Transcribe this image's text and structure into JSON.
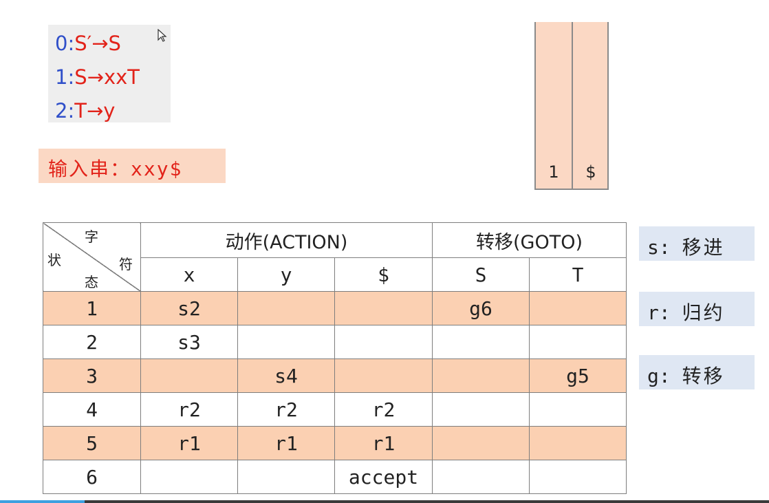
{
  "grammar": {
    "rules": [
      {
        "num": "0:",
        "body": "S′→S"
      },
      {
        "num": "1:",
        "body": "S→xxT"
      },
      {
        "num": "2:",
        "body": "T→y"
      }
    ]
  },
  "input": {
    "label": "输入串：",
    "value": "xxy$"
  },
  "stack": {
    "state": "1",
    "symbol": "$"
  },
  "table": {
    "corner": {
      "top": "字",
      "left": "状",
      "right": "符",
      "bottom": "态"
    },
    "action_header": "动作(ACTION)",
    "goto_header": "转移(GOTO)",
    "action_columns": [
      "x",
      "y",
      "$"
    ],
    "goto_columns": [
      "S",
      "T"
    ],
    "rows": [
      {
        "state": "1",
        "x": "s2",
        "y": "",
        "dollar": "",
        "S": "g6",
        "T": ""
      },
      {
        "state": "2",
        "x": "s3",
        "y": "",
        "dollar": "",
        "S": "",
        "T": ""
      },
      {
        "state": "3",
        "x": "",
        "y": "s4",
        "dollar": "",
        "S": "",
        "T": "g5"
      },
      {
        "state": "4",
        "x": "r2",
        "y": "r2",
        "dollar": "r2",
        "S": "",
        "T": ""
      },
      {
        "state": "5",
        "x": "r1",
        "y": "r1",
        "dollar": "r1",
        "S": "",
        "T": ""
      },
      {
        "state": "6",
        "x": "",
        "y": "",
        "dollar": "accept",
        "S": "",
        "T": ""
      }
    ]
  },
  "legend": [
    {
      "key": "s:",
      "text": "移进"
    },
    {
      "key": "r:",
      "text": "归约"
    },
    {
      "key": "g:",
      "text": "转移"
    }
  ],
  "colors": {
    "red": "#e2231a",
    "blue": "#2f4fc9",
    "shade": "#fbd0b2",
    "legend_bg": "#dfe7f3"
  },
  "playback": {
    "progress": 0.11
  }
}
